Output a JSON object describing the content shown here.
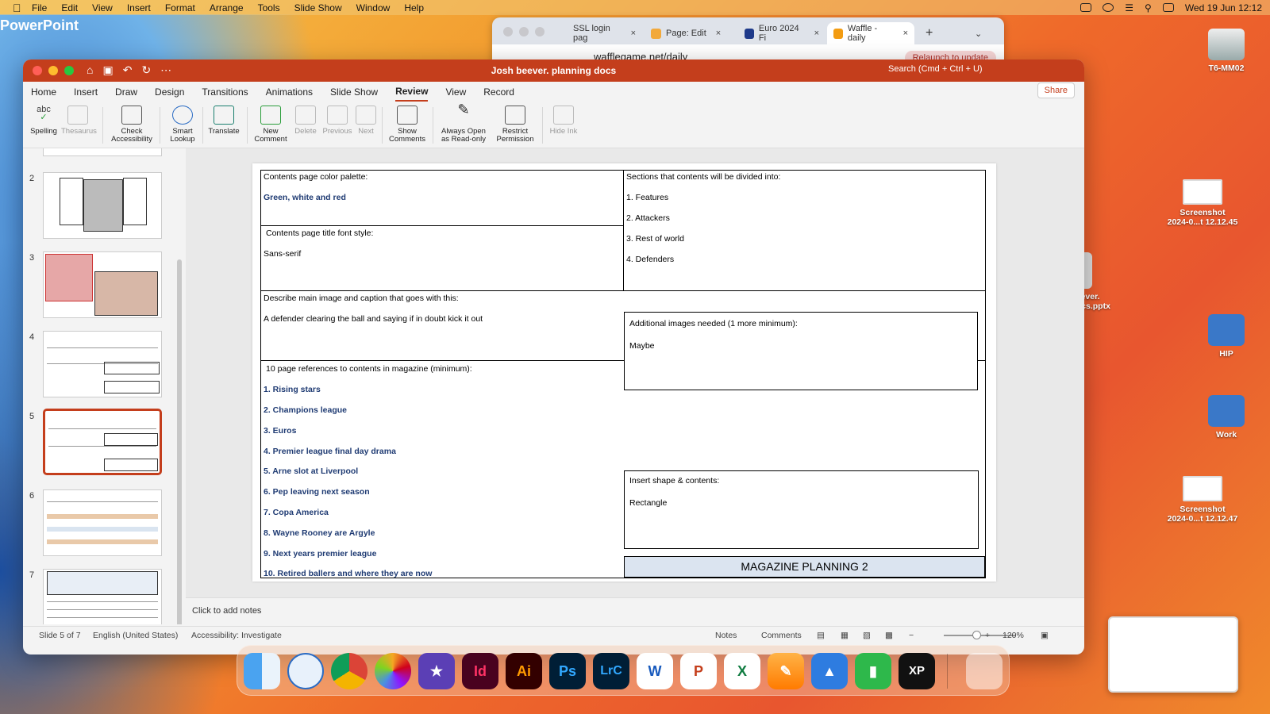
{
  "menubar": {
    "app": "PowerPoint",
    "items": [
      "File",
      "Edit",
      "View",
      "Insert",
      "Format",
      "Arrange",
      "Tools",
      "Slide Show",
      "Window",
      "Help"
    ],
    "clock": "Wed 19 Jun  12:12"
  },
  "browser": {
    "tabs": [
      "SSL login pag",
      "Page: Edit",
      "Euro 2024 Fi",
      "Waffle - daily"
    ],
    "url": "wafflegame.net/daily",
    "relaunch": "Relaunch to update"
  },
  "ppt": {
    "title": "Josh beever. planning docs",
    "search": "Search (Cmd + Ctrl + U)",
    "tabs": [
      "Home",
      "Insert",
      "Draw",
      "Design",
      "Transitions",
      "Animations",
      "Slide Show",
      "Review",
      "View",
      "Record"
    ],
    "active_tab": "Review",
    "share": "Share",
    "ribbon": [
      {
        "label": "Spelling",
        "dim": false
      },
      {
        "label": "Thesaurus",
        "dim": true
      },
      {
        "label": "Check\nAccessibility",
        "dim": false
      },
      {
        "label": "Smart\nLookup",
        "dim": false
      },
      {
        "label": "Translate",
        "dim": false
      },
      {
        "label": "New\nComment",
        "dim": false
      },
      {
        "label": "Delete",
        "dim": true
      },
      {
        "label": "Previous",
        "dim": true
      },
      {
        "label": "Next",
        "dim": true
      },
      {
        "label": "Show\nComments",
        "dim": false
      },
      {
        "label": "Always Open\nas Read-only",
        "dim": false
      },
      {
        "label": "Restrict\nPermission",
        "dim": false
      },
      {
        "label": "Hide Ink",
        "dim": true
      }
    ],
    "slide_numbers": [
      "2",
      "3",
      "4",
      "5",
      "6",
      "7"
    ],
    "notes": "Click to add notes",
    "status": {
      "slide": "Slide 5 of 7",
      "lang": "English (United States)",
      "access": "Accessibility: Investigate",
      "notes": "Notes",
      "comments": "Comments",
      "zoom": "120%"
    }
  },
  "slide": {
    "palette_label": "Contents page color palette:",
    "palette_value": "Green, white and red",
    "font_label": "Contents page title font style:",
    "font_value": "Sans-serif",
    "sections_label": "Sections that contents will be divided into:",
    "sections": [
      "1. Features",
      "2. Attackers",
      "3. Rest of world",
      "4. Defenders"
    ],
    "image_label": "Describe main image and caption that goes with this:",
    "image_value": "A defender clearing the ball and saying if in doubt kick it out",
    "additional_label": "Additional images needed (1 more minimum):",
    "additional_value": "Maybe",
    "refs_label": "10 page references to contents in magazine (minimum):",
    "refs": [
      "1.   Rising stars",
      "2. Champions league",
      "3. Euros",
      "4. Premier league final day drama",
      "5. Arne slot at Liverpool",
      "6. Pep leaving next season",
      "7. Copa America",
      "8. Wayne Rooney are Argyle",
      "9. Next years premier league",
      "10. Retired ballers and where they are now"
    ],
    "shape_label": "Insert shape & contents:",
    "shape_value": "Rectangle",
    "banner": "MAGAZINE PLANNING 2"
  },
  "desktop": {
    "icons": [
      "T6-MM02",
      "Screenshot\n2024-0...t 12.12.45",
      "HIP",
      "Work",
      "Screenshot\n2024-0...t 12.12.47"
    ],
    "file_label": "h beever.\ng docs.pptx"
  },
  "dock": [
    "Finder",
    "Safari",
    "Chrome",
    "Photos",
    "iMovie",
    "InDesign",
    "Illustrator",
    "Photoshop",
    "Lightroom Classic",
    "Word",
    "PowerPoint",
    "Excel",
    "Pages",
    "Keynote",
    "Numbers",
    "XP-Pen",
    "Trash"
  ],
  "dock_glyphs": {
    "InDesign": "Id",
    "Illustrator": "Ai",
    "Photoshop": "Ps",
    "Lightroom Classic": "LrC",
    "Word": "W",
    "PowerPoint": "P",
    "Excel": "X",
    "XP-Pen": "XP"
  }
}
